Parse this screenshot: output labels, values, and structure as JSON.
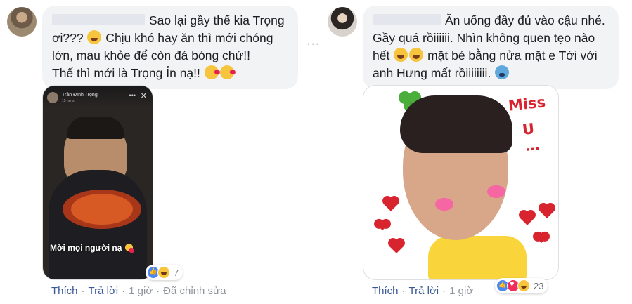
{
  "comments": [
    {
      "author_redacted": true,
      "text_line1": "Sao lại gầy thế kia Trọng",
      "text_line2": "ơi??? ",
      "text_line2b": " Chịu khó hay ăn thì mới chóng",
      "text_line3": "lớn, mau khỏe để còn đá bóng chứ!!",
      "text_line4": "Thế thì mới là Trọng Ỉn nạ!! ",
      "photo": {
        "story_name": "Trần Đình Trọng",
        "story_time": "15 mins",
        "story_close": "✕",
        "story_dots": "•••",
        "caption": "Mời mọi người nạ"
      },
      "reactions": {
        "icons": [
          "like",
          "haha"
        ],
        "count": "7"
      },
      "actions": {
        "like": "Thích",
        "reply": "Trả lời",
        "time": "1 giờ",
        "edited": "Đã chỉnh sửa",
        "sep": "·"
      }
    },
    {
      "author_redacted": true,
      "text_line1": "Ăn uống đầy đủ vào cậu nhé.",
      "text_line2": "Gầy quá rồiiiiii. Nhìn không quen tẹo nào",
      "text_line3a": "hết ",
      "text_line3b": " mặt bé bằng nửa mặt e Tới với",
      "text_line4": "anh Hưng mất rồiiiiiiii. ",
      "sticker": {
        "miss": "Miss",
        "u": "U",
        "dots": "..."
      },
      "reactions": {
        "icons": [
          "like",
          "love",
          "haha"
        ],
        "count": "23"
      },
      "actions": {
        "like": "Thích",
        "reply": "Trả lời",
        "time": "1 giờ",
        "sep": "·"
      }
    }
  ],
  "more_options": "···"
}
